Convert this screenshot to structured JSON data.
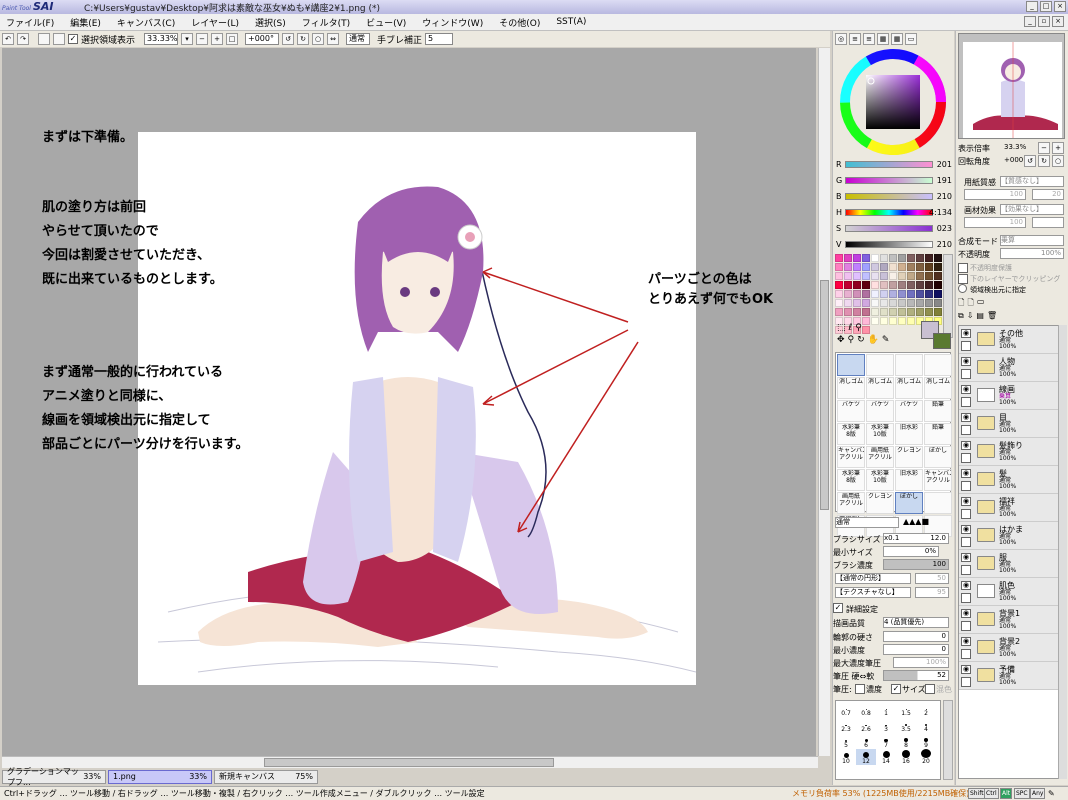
{
  "app": {
    "logo_small": "Paint Tool",
    "logo": "SAI",
    "title": "C:¥Users¥gustav¥Desktop¥阿求は素敵な巫女¥ぬも¥講座2¥1.png (*)"
  },
  "menu": [
    "ファイル(F)",
    "編集(E)",
    "キャンバス(C)",
    "レイヤー(L)",
    "選択(S)",
    "フィルタ(T)",
    "ビュー(V)",
    "ウィンドウ(W)",
    "その他(O)",
    "SST(A)"
  ],
  "toolbar": {
    "selection_display_label": "選択領域表示",
    "zoom_value": "33.33%",
    "rotation_value": "+000°",
    "blend_mode": "通常",
    "stabilizer_label": "手ブレ補正",
    "stabilizer_value": "5"
  },
  "canvas_text": {
    "line1": "まずは下準備。",
    "para2": [
      "肌の塗り方は前回",
      "やらせて頂いたので",
      "今回は割愛させていただき、",
      "既に出来ているものとします。"
    ],
    "para3": [
      "まず通常一般的に行われている",
      "アニメ塗りと同様に、",
      "線画を領域検出元に指定して",
      "部品ごとにパーツ分けを行います。"
    ],
    "annotation": [
      "パーツごとの色は",
      "とりあえず何でもOK"
    ]
  },
  "color_panel": {
    "sliders": [
      {
        "label": "R",
        "value": "201",
        "color": "#e06a9a"
      },
      {
        "label": "G",
        "value": "191",
        "color": "#c040c0"
      },
      {
        "label": "B",
        "value": "210",
        "color": "#a040e0"
      },
      {
        "label": "H",
        "value": "4:134",
        "color": "#ff4040"
      },
      {
        "label": "S",
        "value": "023",
        "color": "#8040c0"
      },
      {
        "label": "V",
        "value": "210",
        "color": "#303030"
      }
    ],
    "primary_color": "#c9bfd2",
    "secondary_color": "#5a7a30"
  },
  "tools": [
    "",
    "",
    "",
    "",
    "消しゴム",
    "消しゴム",
    "消しゴム",
    "消しゴム",
    "バケツ",
    "バケツ",
    "バケツ",
    "鉛筆",
    "水彩筆\n8版",
    "水彩筆\n10版",
    "旧水彩",
    "鉛筆",
    "キャンバス\nアクリル",
    "画用紙\nアクリル",
    "クレヨン",
    "ぼかし",
    "水彩筆\n8版",
    "水彩筆\n10版",
    "旧水彩",
    "キャンバス\nアクリル",
    "画用紙\nアクリル",
    "クレヨン",
    "ぼかし",
    "",
    "選択消し",
    "",
    "",
    ""
  ],
  "brush": {
    "blend": "通常",
    "size_label": "ブラシサイズ",
    "size_mult": "x0.1",
    "size_value": "12.0",
    "min_size_label": "最小サイズ",
    "min_size_value": "0%",
    "density_label": "ブラシ濃度",
    "density_value": "100",
    "shape": "【通常の円形】",
    "shape_value": "50",
    "texture": "【テクスチャなし】",
    "texture_value": "95",
    "detail_label": "詳細設定",
    "quality_label": "描画品質",
    "quality_value": "4 (品質優先)",
    "edge_label": "輪郭の硬さ",
    "edge_value": "0",
    "min_density_label": "最小濃度",
    "min_density_value": "0",
    "max_density_label": "最大濃度筆圧",
    "max_density_value": "100%",
    "pressure_label": "筆圧 硬⇔軟",
    "pressure_value": "52",
    "pressure2_label": "筆圧:",
    "density_chk": "濃度",
    "size_chk": "サイズ",
    "blend_chk": "混色",
    "sizes": [
      "0.7",
      "0.8",
      "1",
      "1.5",
      "2",
      "2.3",
      "2.6",
      "3",
      "3.5",
      "4",
      "5",
      "6",
      "7",
      "8",
      "9",
      "10",
      "12",
      "14",
      "16",
      "20"
    ]
  },
  "navigator": {
    "zoom_label": "表示倍率",
    "zoom_value": "33.3%",
    "angle_label": "回転角度",
    "angle_value": "+000°"
  },
  "layer_props": {
    "paper_label": "用紙質感",
    "paper_value": "【質感なし】",
    "paper_num1": "100",
    "paper_num2": "20",
    "effect_label": "画材効果",
    "effect_value": "【効果なし】",
    "effect_num1": "100",
    "effect_num2": "",
    "blend_label": "合成モード",
    "blend_value": "乗算",
    "opacity_label": "不透明度",
    "opacity_value": "100%",
    "protect_opacity": "不透明度保護",
    "clip_lower": "下のレイヤーでクリッピング",
    "region_source": "領域検出元に指定"
  },
  "layers": [
    {
      "name": "その他",
      "mode": "通常",
      "opacity": "100%",
      "type": "folder"
    },
    {
      "name": "人物",
      "mode": "通常",
      "opacity": "100%",
      "type": "folder"
    },
    {
      "name": "線画",
      "mode": "乗算",
      "opacity": "100%",
      "type": "layer"
    },
    {
      "name": "目",
      "mode": "通常",
      "opacity": "100%",
      "type": "folder"
    },
    {
      "name": "髪飾り",
      "mode": "通常",
      "opacity": "100%",
      "type": "folder"
    },
    {
      "name": "髪",
      "mode": "通常",
      "opacity": "100%",
      "type": "folder"
    },
    {
      "name": "襦袢",
      "mode": "通常",
      "opacity": "100%",
      "type": "folder"
    },
    {
      "name": "はかま",
      "mode": "通常",
      "opacity": "100%",
      "type": "folder"
    },
    {
      "name": "服",
      "mode": "通常",
      "opacity": "100%",
      "type": "folder"
    },
    {
      "name": "肌色",
      "mode": "通常",
      "opacity": "100%",
      "type": "layer"
    },
    {
      "name": "背景1",
      "mode": "通常",
      "opacity": "100%",
      "type": "folder"
    },
    {
      "name": "背景2",
      "mode": "通常",
      "opacity": "100%",
      "type": "folder"
    },
    {
      "name": "予備",
      "mode": "通常",
      "opacity": "100%",
      "type": "folder"
    }
  ],
  "tabs": [
    {
      "name": "グラデーションマップフ...",
      "zoom": "33%"
    },
    {
      "name": "1.png",
      "zoom": "33%"
    },
    {
      "name": "新規キャンバス",
      "zoom": "75%"
    }
  ],
  "status": {
    "hint": "Ctrl+ドラッグ … ツール移動 / 右ドラッグ … ツール移動・複製 / 右クリック … ツール作成メニュー / ダブルクリック … ツール設定",
    "memory": "メモリ負荷率 53% (1225MB使用/2215MB確保)",
    "keys": [
      "Shift",
      "Ctrl",
      "Alt",
      "SPC",
      "Any"
    ]
  }
}
